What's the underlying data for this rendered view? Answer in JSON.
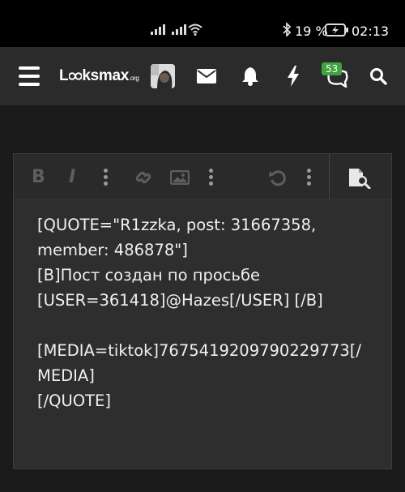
{
  "status_bar": {
    "battery_percent": "19 %",
    "time": "02:13",
    "icons": [
      "signal-icon",
      "signal-icon",
      "wifi-icon",
      "bluetooth-icon",
      "battery-charging-icon"
    ]
  },
  "navbar": {
    "logo_main": "Lüksmax",
    "logo_brand_l": "L",
    "logo_brand_rest": "ksmax",
    "logo_suffix": ".org",
    "messages_badge": "53",
    "icons": [
      "menu-icon",
      "avatar",
      "envelope-icon",
      "bell-icon",
      "lightning-icon",
      "chat-icon",
      "search-icon"
    ]
  },
  "editor": {
    "toolbar": [
      "bold-icon",
      "italic-icon",
      "more-icon",
      "link-icon",
      "image-icon",
      "more-icon",
      "undo-icon",
      "more-icon",
      "preview-icon"
    ],
    "lines": [
      "[QUOTE=\"R1zzka, post: 31667358,",
      "member: 486878\"]",
      "[B]Пост создан по просьбе",
      "[USER=361418]@Hazes[/USER] [/B]",
      "",
      "[MEDIA=tiktok]7675419209790229773[/",
      "MEDIA]",
      "[/QUOTE]"
    ]
  }
}
